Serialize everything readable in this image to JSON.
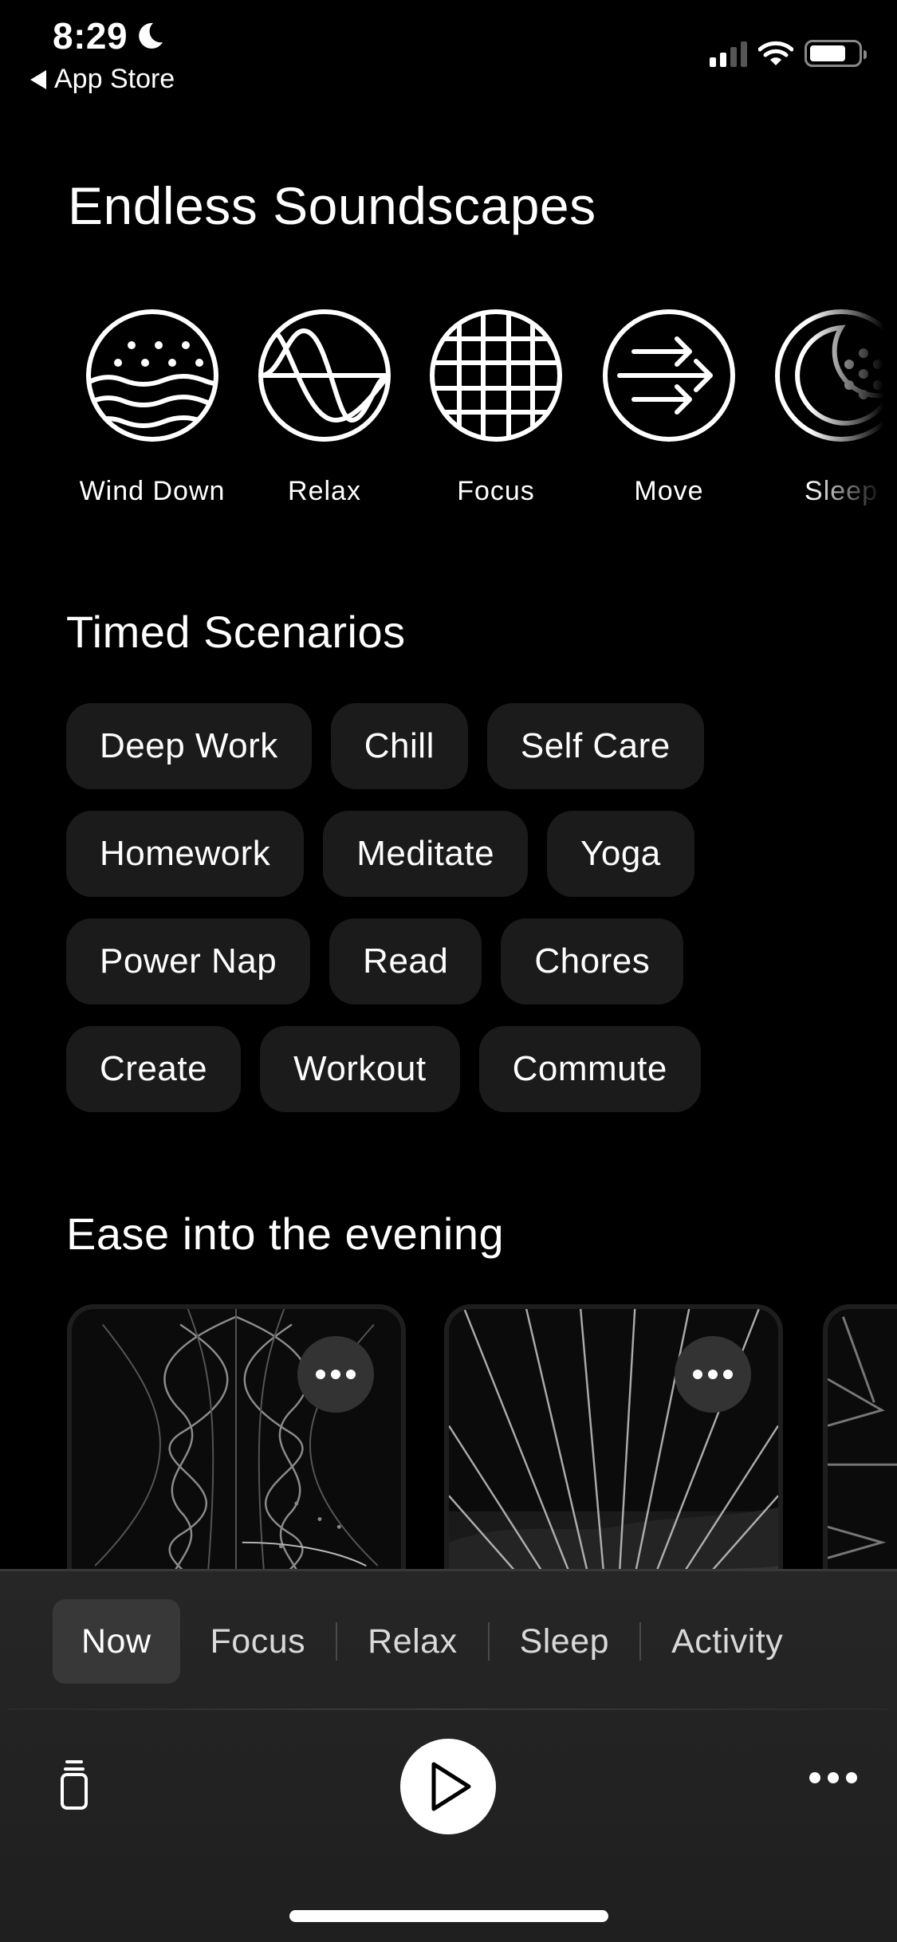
{
  "status_bar": {
    "time": "8:29",
    "focus_icon": "moon-icon",
    "back_label": "App Store",
    "signal_bars": 2,
    "signal_bars_total": 4,
    "battery_level": 0.75
  },
  "soundscapes": {
    "title": "Endless Soundscapes",
    "items": [
      {
        "label": "Wind Down",
        "icon": "waves-dots-icon"
      },
      {
        "label": "Relax",
        "icon": "sine-waves-icon"
      },
      {
        "label": "Focus",
        "icon": "grid-icon"
      },
      {
        "label": "Move",
        "icon": "arrows-icon"
      },
      {
        "label": "Sleep",
        "icon": "moon-dots-icon"
      }
    ]
  },
  "timed_scenarios": {
    "title": "Timed Scenarios",
    "rows": [
      [
        "Deep Work",
        "Chill",
        "Self Care"
      ],
      [
        "Homework",
        "Meditate",
        "Yoga"
      ],
      [
        "Power Nap",
        "Read",
        "Chores"
      ],
      [
        "Create",
        "Workout",
        "Commute"
      ]
    ]
  },
  "evening": {
    "title": "Ease into the evening",
    "cards": [
      {
        "art": "helix-waves",
        "more_icon": "ellipsis-icon"
      },
      {
        "art": "radiating-lines",
        "more_icon": "ellipsis-icon"
      },
      {
        "art": "geometric-lines"
      }
    ]
  },
  "bottom_bar": {
    "tabs": [
      {
        "label": "Now",
        "active": true
      },
      {
        "label": "Focus",
        "active": false
      },
      {
        "label": "Relax",
        "active": false
      },
      {
        "label": "Sleep",
        "active": false
      },
      {
        "label": "Activity",
        "active": false
      }
    ],
    "controls": {
      "left_icon": "queue-stack-icon",
      "center_icon": "play-icon",
      "right_icon": "ellipsis-icon"
    }
  },
  "colors": {
    "background": "#000000",
    "chip_bg": "#1b1b1b",
    "panel_bg": "#232323",
    "active_tab_bg": "#383838",
    "text": "#ffffff"
  }
}
